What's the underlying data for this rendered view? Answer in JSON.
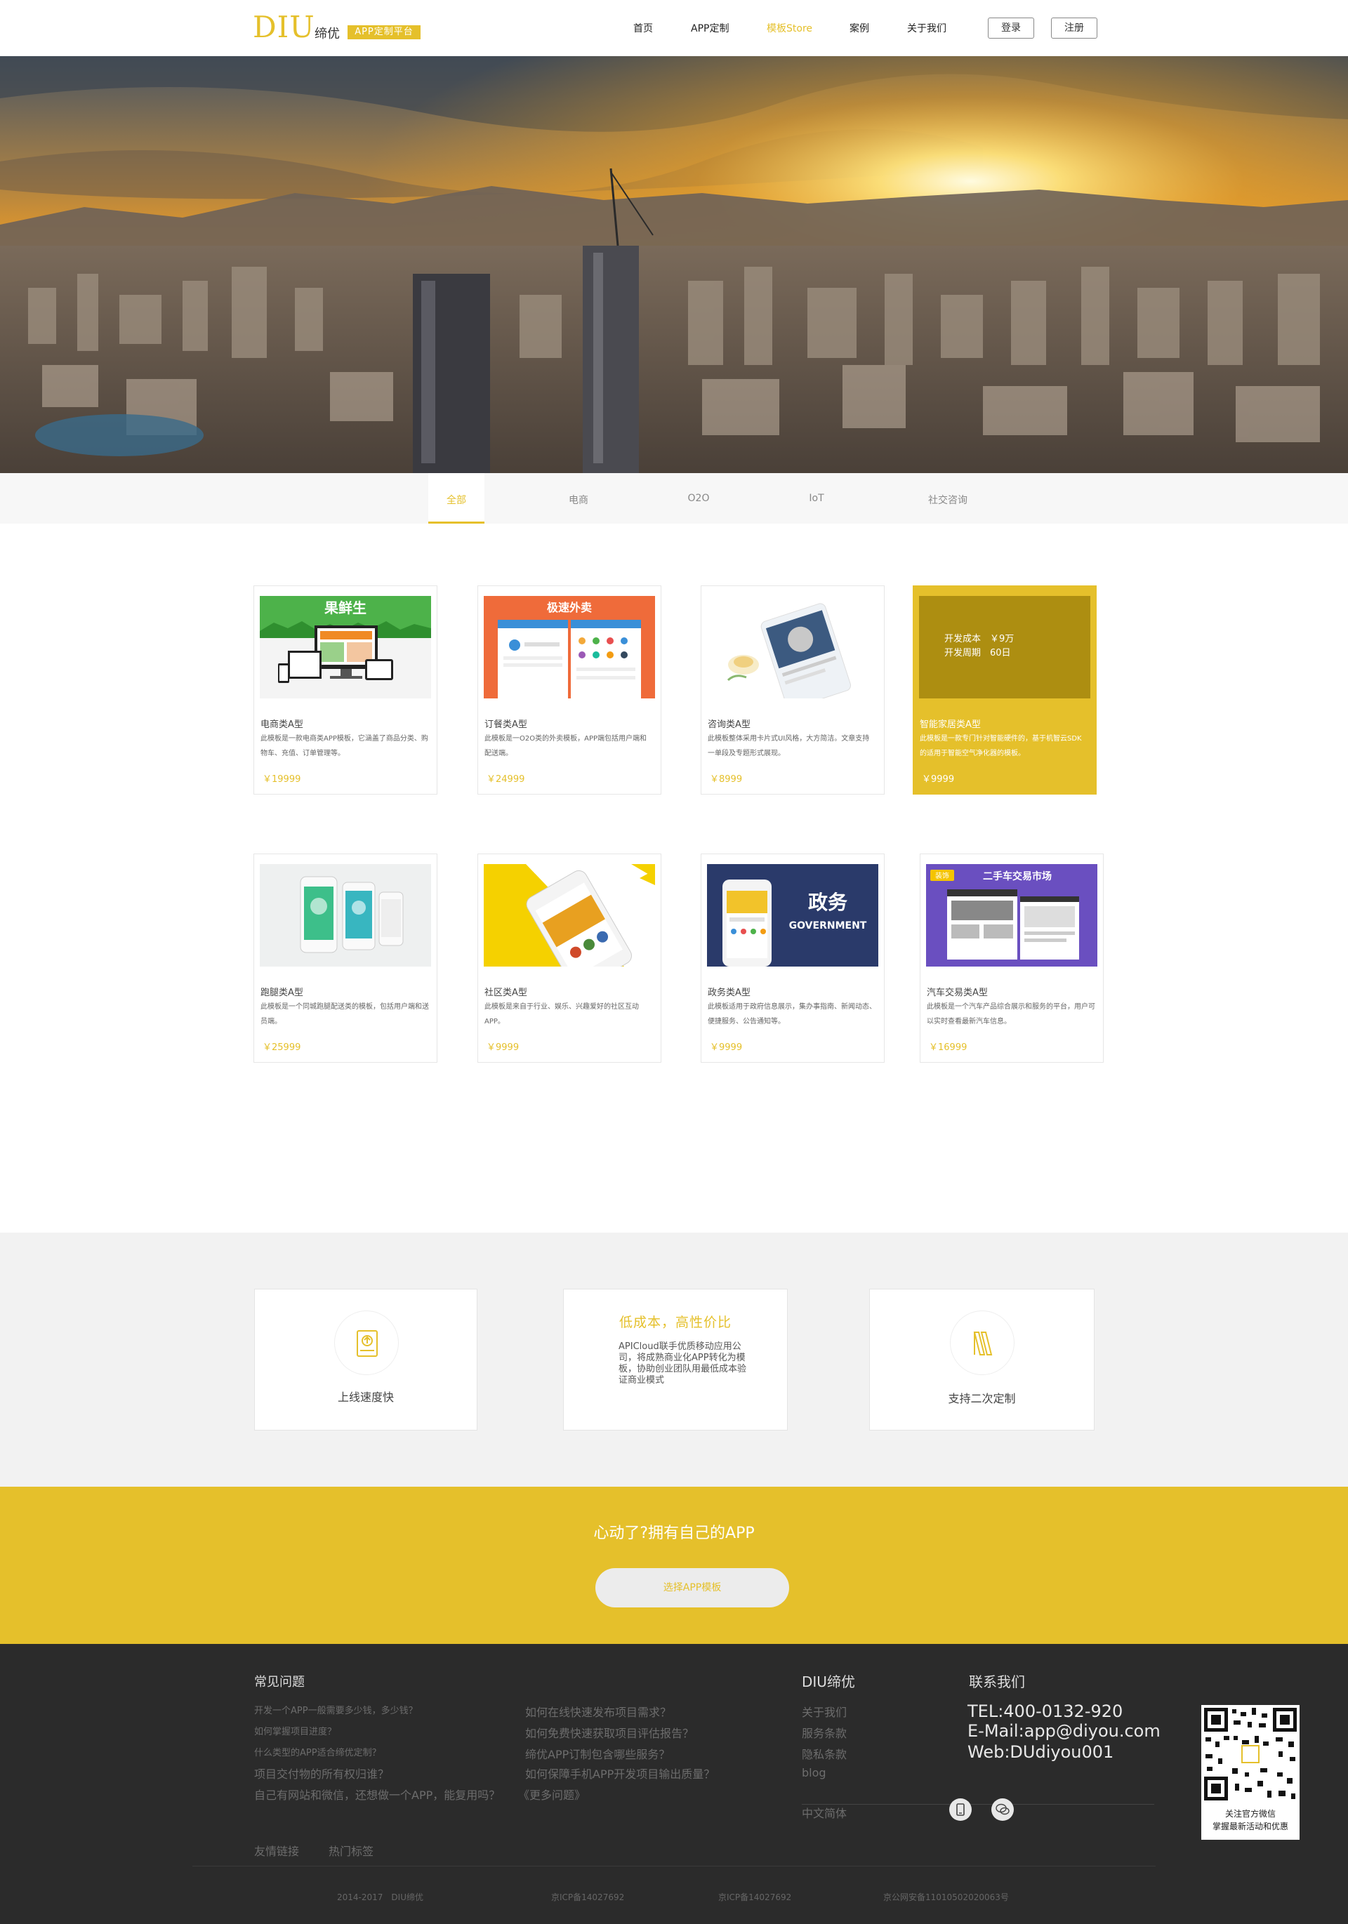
{
  "header": {
    "logo": "DIU",
    "logo_sub": "缔优",
    "logo_tag": "APP定制平台",
    "nav": [
      "首页",
      "APP定制",
      "模板Store",
      "案例",
      "关于我们"
    ],
    "login": "登录",
    "register": "注册"
  },
  "tabs": [
    "全部",
    "电商",
    "O2O",
    "IoT",
    "社交咨询"
  ],
  "cards": [
    {
      "title": "电商类A型",
      "desc": "此模板是一款电商类APP模板，它涵盖了商品分类、购物车、充值、订单管理等。",
      "price": "￥19999"
    },
    {
      "title": "订餐类A型",
      "desc": "此模板是一O2O类的外卖模板，APP端包括用户端和配送端。",
      "price": "￥24999"
    },
    {
      "title": "咨询类A型",
      "desc": "此模板整体采用卡片式UI风格，大方简洁。文章支持一单段及专题形式展现。",
      "price": "￥8999"
    },
    {
      "title": "智能家居类A型",
      "desc": "此模板是一款专门针对智能硬件的，基于机智云SDK的适用于智能空气净化器的模板。",
      "price": "￥9999",
      "overlay": [
        "开发成本　￥9万",
        "开发周期　60日"
      ]
    },
    {
      "title": "跑腿类A型",
      "desc": "此模板是一个同城跑腿配送类的模板，包括用户端和送员端。",
      "price": "￥25999"
    },
    {
      "title": "社区类A型",
      "desc": "此模板是来自于行业、娱乐、兴趣爱好的社区互动APP。",
      "price": "￥9999"
    },
    {
      "title": "政务类A型",
      "desc": "此模板适用于政府信息展示，集办事指南、新闻动态、便捷服务、公告通知等。",
      "price": "￥9999"
    },
    {
      "title": "汽车交易类A型",
      "desc": "此模板是一个汽车产品综合展示和服务的平台，用户可以实时查看最新汽车信息。",
      "price": "￥16999"
    }
  ],
  "thumb_text": {
    "fresh": "果鲜生",
    "food": "极速外卖",
    "gov_cn": "政务",
    "gov_en": "GOVERNMENT",
    "car_badge": "装饰",
    "car": "二手车交易市场"
  },
  "features": {
    "f1": "上线速度快",
    "f2_title": "低成本，高性价比",
    "f2_desc": "APICloud联手优质移动应用公司，将成熟商业化APP转化为模板，协助创业团队用最低成本验证商业模式",
    "f3": "支持二次定制"
  },
  "cta": {
    "title": "心动了?拥有自己的APP",
    "button": "选择APP模板"
  },
  "footer": {
    "faq_title": "常见问题",
    "faq_left": [
      "开发一个APP一般需要多少钱，多少钱？",
      "如何掌握项目进度？",
      "什么类型的APP适合缔优定制？",
      "项目交付物的所有权归谁？",
      "自己有网站和微信，还想做一个APP，能复用吗？"
    ],
    "faq_right": [
      "如何在线快速发布项目需求？",
      "如何免费快速获取项目评估报告？",
      "缔优APP订制包含哪些服务？",
      "如何保障手机APP开发项目输出质量？"
    ],
    "faq_more": "《更多问题》",
    "diu_title": "DIU缔优",
    "diu_links": [
      "关于我们",
      "服务条款",
      "隐私条款",
      "blog"
    ],
    "lang": "中文简体",
    "contact_title": "联系我们",
    "tel": "TEL:400-0132-920",
    "email": "E-Mail:app@diyou.com",
    "web": "Web:DUdiyou001",
    "qr_caption1": "关注官方微信",
    "qr_caption2": "掌握最新活动和优惠",
    "friend_links": "友情链接",
    "hot_tags": "热门标签",
    "copyright": "2014-2017　DIU缔优",
    "icp1": "京ICP备14027692",
    "icp2": "京ICP备14027692",
    "police": "京公网安备11010502020063号"
  },
  "colors": {
    "accent": "#e5c02b",
    "footer_bg": "#2b2b2b",
    "section_bg": "#f2f2f2"
  }
}
